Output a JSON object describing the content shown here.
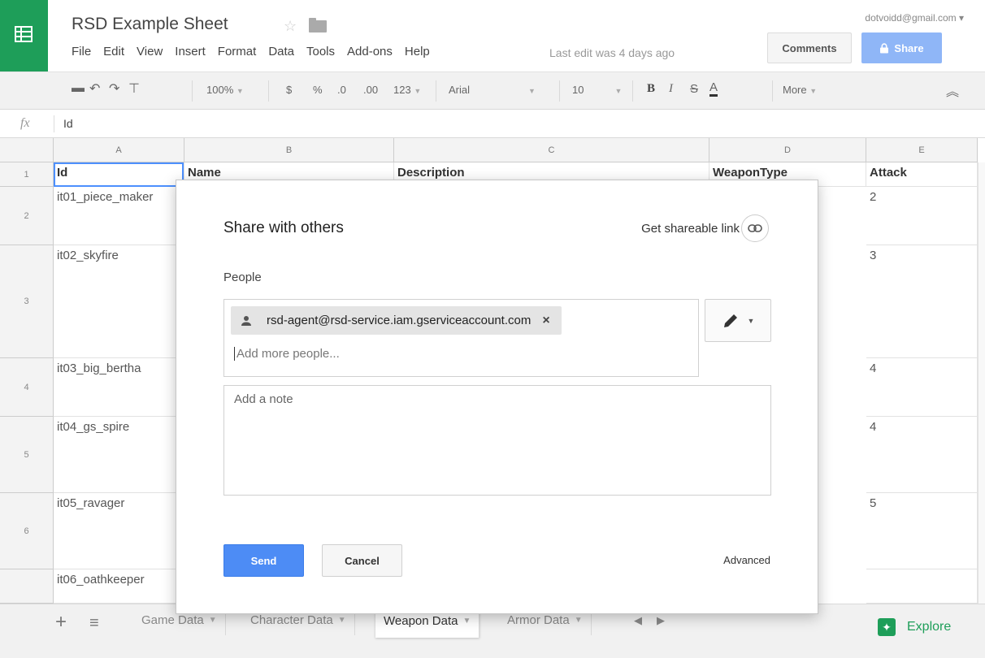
{
  "header": {
    "doc_title": "RSD Example Sheet",
    "account": "dotvoidd@gmail.com ▾",
    "last_edit": "Last edit was 4 days ago",
    "comments_label": "Comments",
    "share_label": "Share",
    "menu": [
      "File",
      "Edit",
      "View",
      "Insert",
      "Format",
      "Data",
      "Tools",
      "Add-ons",
      "Help"
    ]
  },
  "toolbar": {
    "zoom": "100%",
    "currency": "$",
    "percent": "%",
    "dec_less": ".0",
    "dec_more": ".00",
    "format": "123",
    "font": "Arial",
    "font_size": "10",
    "bold": "B",
    "italic": "I",
    "strike": "S",
    "text_color": "A",
    "more": "More"
  },
  "formula": {
    "fx": "fx",
    "value": "Id"
  },
  "grid": {
    "columns": [
      "A",
      "B",
      "C",
      "D",
      "E"
    ],
    "rows": [
      "1",
      "2",
      "3",
      "4",
      "5",
      "6",
      ""
    ],
    "header_row": [
      "Id",
      "Name",
      "Description",
      "WeaponType",
      "Attack"
    ],
    "col_a": [
      "it01_piece_maker",
      "it02_skyfire",
      "it03_big_bertha",
      "it04_gs_spire",
      "it05_ravager",
      "it06_oathkeeper"
    ],
    "col_e": [
      "2",
      "3",
      "4",
      "4",
      "5",
      ""
    ]
  },
  "sheets": {
    "tabs": [
      "Game Data",
      "Character Data",
      "Weapon Data",
      "Armor Data"
    ],
    "active": "Weapon Data",
    "explore_label": "Explore"
  },
  "dialog": {
    "title": "Share with others",
    "get_link": "Get shareable link",
    "people_label": "People",
    "chip_email": "rsd-agent@rsd-service.iam.gserviceaccount.com",
    "chip_remove": "×",
    "add_placeholder": "Add more people...",
    "note_placeholder": "Add a note",
    "send": "Send",
    "cancel": "Cancel",
    "advanced": "Advanced"
  },
  "colors": {
    "brand_green": "#1e9e59",
    "primary_blue": "#4d8cf5",
    "share_blue": "#8fb6f7"
  }
}
